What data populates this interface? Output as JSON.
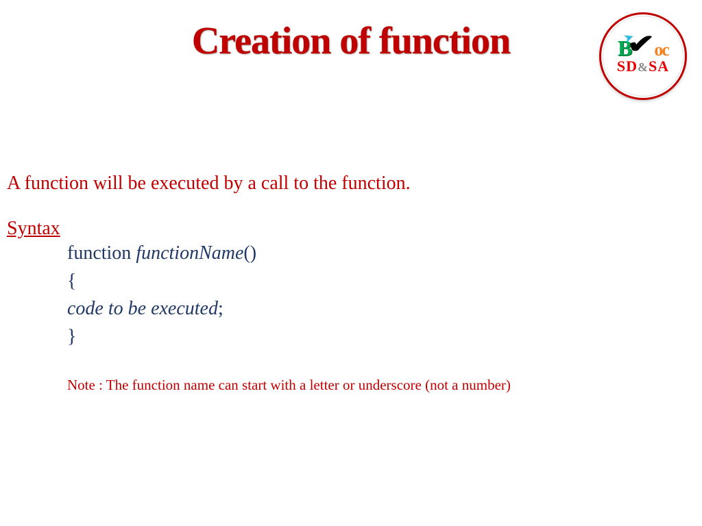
{
  "title": "Creation of function",
  "logo": {
    "b": "B",
    "oc": "oc",
    "sd": "SD",
    "amp": "&",
    "sa": "SA"
  },
  "intro": "A function will be executed by a call to the function.",
  "syntax_label": "Syntax",
  "code": {
    "line1_kw": "function ",
    "line1_fn": "functionName",
    "line1_paren": "()",
    "line2": "{",
    "line3_body": "code to be executed",
    "line3_semi": ";",
    "line4": "}"
  },
  "note": "Note : The function name can start with a letter or underscore (not a number)"
}
